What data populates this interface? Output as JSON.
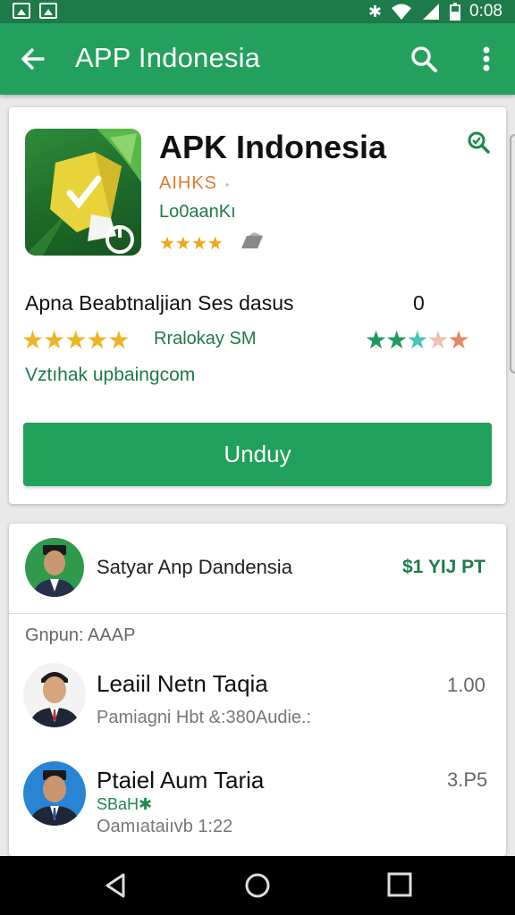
{
  "status_bar": {
    "time": "0:08"
  },
  "app_bar": {
    "title": "APP Indonesia"
  },
  "app_card": {
    "name": "APK Indonesia",
    "developer": "AIHKS",
    "developer_suffix": "•",
    "sub_label": "Lo0aanKı",
    "small_rating_stars": "★★★★",
    "description": "Apna Beabtnaljian Ses dasus",
    "count": "0",
    "stars_left": "★★★★★",
    "rating_label": "Rralokay SM",
    "stars_right": "★★★★★",
    "green_link": "Vztıhak upbaingcom",
    "install_label": "Unduy"
  },
  "developer_card": {
    "title": "Satyar Anp Dandensia",
    "price": "$1 YIJ PT",
    "section_label": "Gnpun: AAAP",
    "items": [
      {
        "title": "Leaiil Netn Taqia",
        "number": "1.00",
        "subtitle": "Pamiagni Hbt &:380Audie.:",
        "green": ""
      },
      {
        "title": "Ptaiel Aum Taria",
        "number": "3.P5",
        "subtitle": "Oamıataiıvb 1:22",
        "green": "SBaH✱"
      }
    ]
  },
  "colors": {
    "status_bar": "#1d7a49",
    "app_bar": "#24a05d",
    "install_button": "#21a05c",
    "accent_text": "#1e7b4a",
    "developer_text": "#e07a2c"
  },
  "icons": {
    "back": "arrow-back-icon",
    "search": "search-icon",
    "more": "more-vert-icon",
    "share": "refresh-search-icon",
    "nav_back": "nav-back-icon",
    "nav_home": "nav-home-icon",
    "nav_recent": "nav-recent-icon"
  }
}
